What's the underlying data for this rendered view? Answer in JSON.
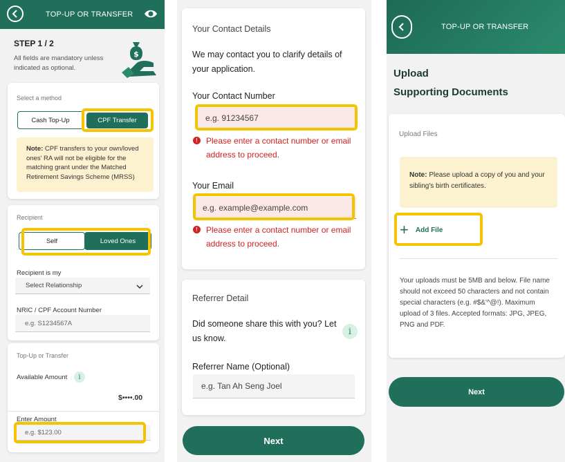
{
  "screen1": {
    "header_title": "TOP-UP OR TRANSFER",
    "step_title": "STEP 1 / 2",
    "step_desc": "All fields are mandatory unless indicated as optional.",
    "method_label": "Select a method",
    "method_options": [
      "Cash Top-Up",
      "CPF Transfer"
    ],
    "method_selected": "CPF Transfer",
    "note_bold": "Note:",
    "note_text": " CPF transfers to your own/loved ones' RA will not be eligible for the matching grant under the Matched Retirement Savings Scheme (MRSS)",
    "recipient_label": "Recipient",
    "recipient_options": [
      "Self",
      "Loved Ones"
    ],
    "recipient_selected": "Loved Ones",
    "relationship_label": "Recipient is my",
    "relationship_value": "Select Relationship",
    "nric_label": "NRIC / CPF Account Number",
    "nric_placeholder": "e.g. S1234567A",
    "topup_label": "Top-Up or Transfer",
    "available_label": "Available Amount",
    "info_glyph": "i",
    "available_value": "$••••.00",
    "amount_label": "Enter Amount",
    "amount_placeholder": "e.g. $123.00"
  },
  "screen2": {
    "contact_title": "Your Contact Details",
    "contact_intro": "We may contact you to clarify details of your application.",
    "number_label": "Your Contact Number",
    "number_placeholder": "e.g. 91234567",
    "error_glyph": "!",
    "error_text": "Please enter a contact number or email address to proceed.",
    "email_label": "Your Email",
    "email_placeholder": "e.g. example@example.com",
    "referrer_title": "Referrer Detail",
    "referrer_question": "Did someone share this with you? Let us know.",
    "info_glyph": "i",
    "referrer_label": "Referrer Name (Optional)",
    "referrer_placeholder": "e.g. Tan Ah Seng Joel",
    "next_label": "Next"
  },
  "screen3": {
    "header_title": "TOP-UP OR TRANSFER",
    "heading_line1": "Upload",
    "heading_line2": "Supporting Documents",
    "upload_label": "Upload Files",
    "note_bold": "Note:",
    "note_text": " Please upload a copy of you and your sibling's birth certificates.",
    "add_glyph": "+",
    "add_file_label": "Add File",
    "upload_rules": "Your uploads must be 5MB and below. File name should not exceed 50 characters and not contain special characters (e.g. #$&'^@!). Maximum upload of 3 files. Accepted formats: JPG, JPEG, PNG and PDF.",
    "next_label": "Next"
  },
  "colors": {
    "brand_green": "#1f6f5a",
    "highlight_yellow": "#f5c400",
    "error_red": "#d32020",
    "note_bg": "#fdf2cf"
  }
}
